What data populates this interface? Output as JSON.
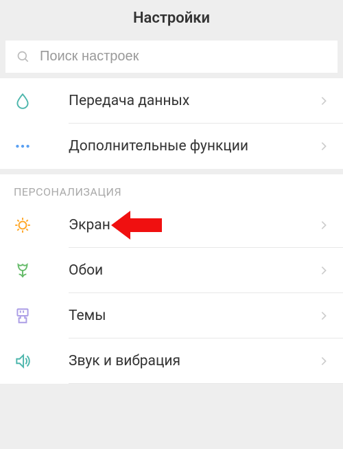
{
  "header": {
    "title": "Настройки"
  },
  "search": {
    "placeholder": "Поиск настроек"
  },
  "group1": {
    "items": [
      {
        "label": "Передача данных",
        "icon": "droplet"
      },
      {
        "label": "Дополнительные функции",
        "icon": "more"
      }
    ]
  },
  "group2": {
    "title": "ПЕРСОНАЛИЗАЦИЯ",
    "items": [
      {
        "label": "Экран",
        "icon": "sun",
        "highlighted": true
      },
      {
        "label": "Обои",
        "icon": "tulip",
        "highlighted": false
      },
      {
        "label": "Темы",
        "icon": "brush",
        "highlighted": false
      },
      {
        "label": "Звук и вибрация",
        "icon": "speaker",
        "highlighted": false
      }
    ]
  },
  "colors": {
    "teal": "#4db6ac",
    "blue": "#5aa0f2",
    "orange": "#ffa726",
    "green": "#66bb6a",
    "purple": "#ab9de6",
    "pointer": "#f01010"
  }
}
